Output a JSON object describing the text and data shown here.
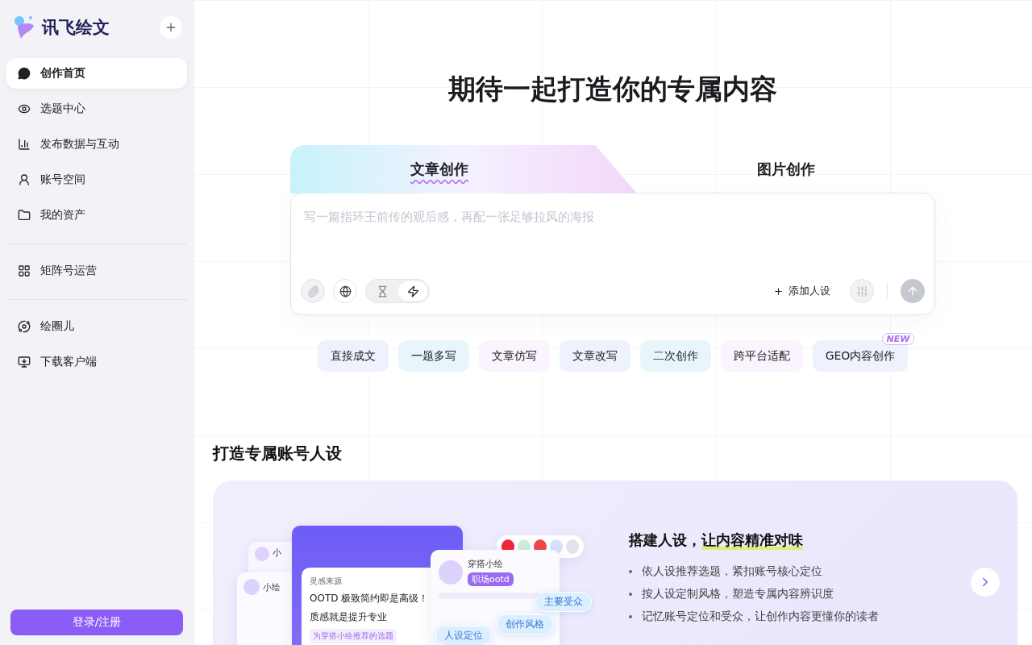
{
  "sidebar": {
    "logo_text": "讯飞绘文",
    "nav_groups": [
      [
        {
          "label": "创作首页",
          "selected": true
        },
        {
          "label": "选题中心",
          "selected": false
        },
        {
          "label": "发布数据与互动",
          "selected": false
        },
        {
          "label": "账号空间",
          "selected": false
        },
        {
          "label": "我的资产",
          "selected": false
        }
      ],
      [
        {
          "label": "矩阵号运营",
          "selected": false
        }
      ],
      [
        {
          "label": "绘圈儿",
          "selected": false
        },
        {
          "label": "下载客户端",
          "selected": false
        }
      ]
    ],
    "login_button": "登录/注册"
  },
  "hero": {
    "title": "期待一起打造你的专属内容"
  },
  "composer": {
    "tabs": [
      {
        "label": "文章创作",
        "selected": true
      },
      {
        "label": "图片创作",
        "selected": false
      }
    ],
    "placeholder": "写一篇指环王前传的观后感，再配一张足够拉风的海报",
    "mode_toggle": [
      {
        "kind": "hourglass",
        "selected": false
      },
      {
        "kind": "bolt",
        "selected": true
      }
    ],
    "add_persona": "添加人设"
  },
  "chips": [
    {
      "label": "直接成文",
      "color": "#edf2fd"
    },
    {
      "label": "一题多写",
      "color": "#e8f6fb"
    },
    {
      "label": "文章仿写",
      "color": "#fbf3fd"
    },
    {
      "label": "文章改写",
      "color": "#edf2fd"
    },
    {
      "label": "二次创作",
      "color": "#e8f6fb"
    },
    {
      "label": "跨平台适配",
      "color": "#fbf3fd"
    },
    {
      "label": "GEO内容创作",
      "color": "#edf2fd",
      "badge": "NEW"
    }
  ],
  "persona_section": {
    "title": "打造专属账号人设",
    "heading_plain": "搭建人设，",
    "heading_highlight": "让内容精准对味",
    "bullets": [
      "依人设推荐选题，紧扣账号核心定位",
      "按人设定制风格，塑造专属内容辨识度",
      "记忆账号定位和受众，让创作内容更懂你的读者"
    ],
    "illustration": {
      "back_card_names": [
        "小",
        "小绘"
      ],
      "source_label": "灵感来源",
      "source_lines": [
        "OOTD 极致简约即是高级！",
        "质感就是提升专业"
      ],
      "source_tag": "为穿搭小绘推荐的选题",
      "profile_name": "穿搭小绘",
      "profile_tag": "职场ootd",
      "bubbles": [
        "主要受众",
        "创作风格",
        "人设定位"
      ]
    }
  }
}
